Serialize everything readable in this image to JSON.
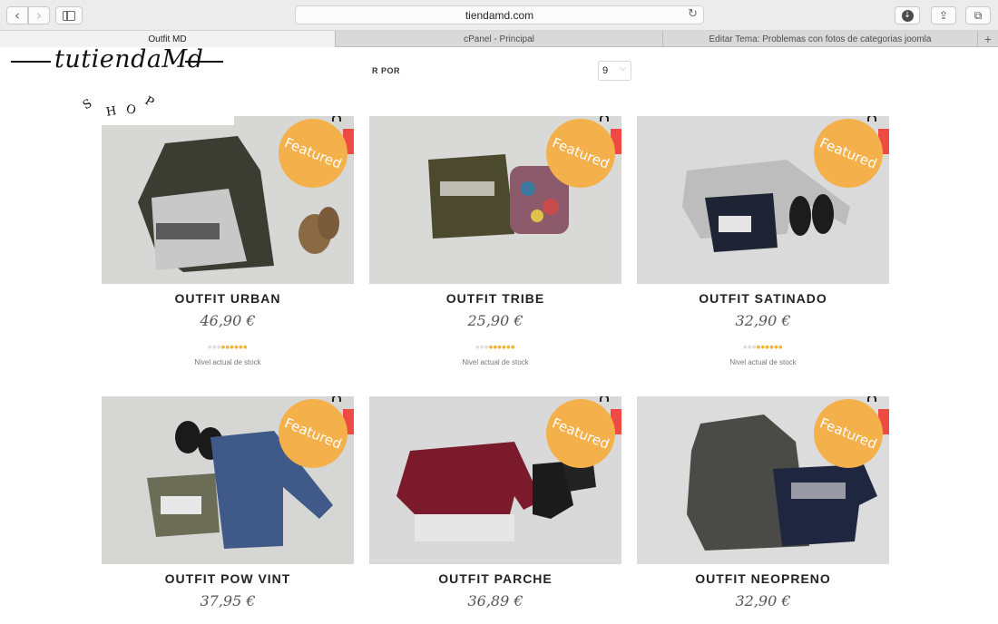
{
  "browser": {
    "url": "tiendamd.com",
    "tabs": [
      {
        "label": "Outfit MD",
        "active": true
      },
      {
        "label": "cPanel - Principal",
        "active": false
      },
      {
        "label": "Editar Tema: Problemas con fotos de categorias joomla",
        "active": false
      }
    ],
    "add_tab": "+"
  },
  "logo": {
    "text": "tutiendaMd",
    "subtitle_letters": [
      "S",
      "H",
      "O",
      "P"
    ]
  },
  "sorting": {
    "label": "R POR",
    "per_page_value": "9"
  },
  "badge_label": "Featured",
  "stock_label": "Nivel actual de stock",
  "products": [
    {
      "title": "OUTFIT URBAN",
      "price": "46,90 €",
      "stock_filled": 6,
      "stock_total": 9
    },
    {
      "title": "OUTFIT TRIBE",
      "price": "25,90 €",
      "stock_filled": 6,
      "stock_total": 9
    },
    {
      "title": "OUTFIT SATINADO",
      "price": "32,90 €",
      "stock_filled": 6,
      "stock_total": 9
    },
    {
      "title": "OUTFIT POW VINT",
      "price": "37,95 €"
    },
    {
      "title": "OUTFIT PARCHE",
      "price": "36,89 €"
    },
    {
      "title": "OUTFIT NEOPRENO",
      "price": "32,90 €"
    }
  ],
  "colors": {
    "badge": "#f4b04a",
    "tag": "#ef4b45",
    "stars": "#f2b43b"
  }
}
